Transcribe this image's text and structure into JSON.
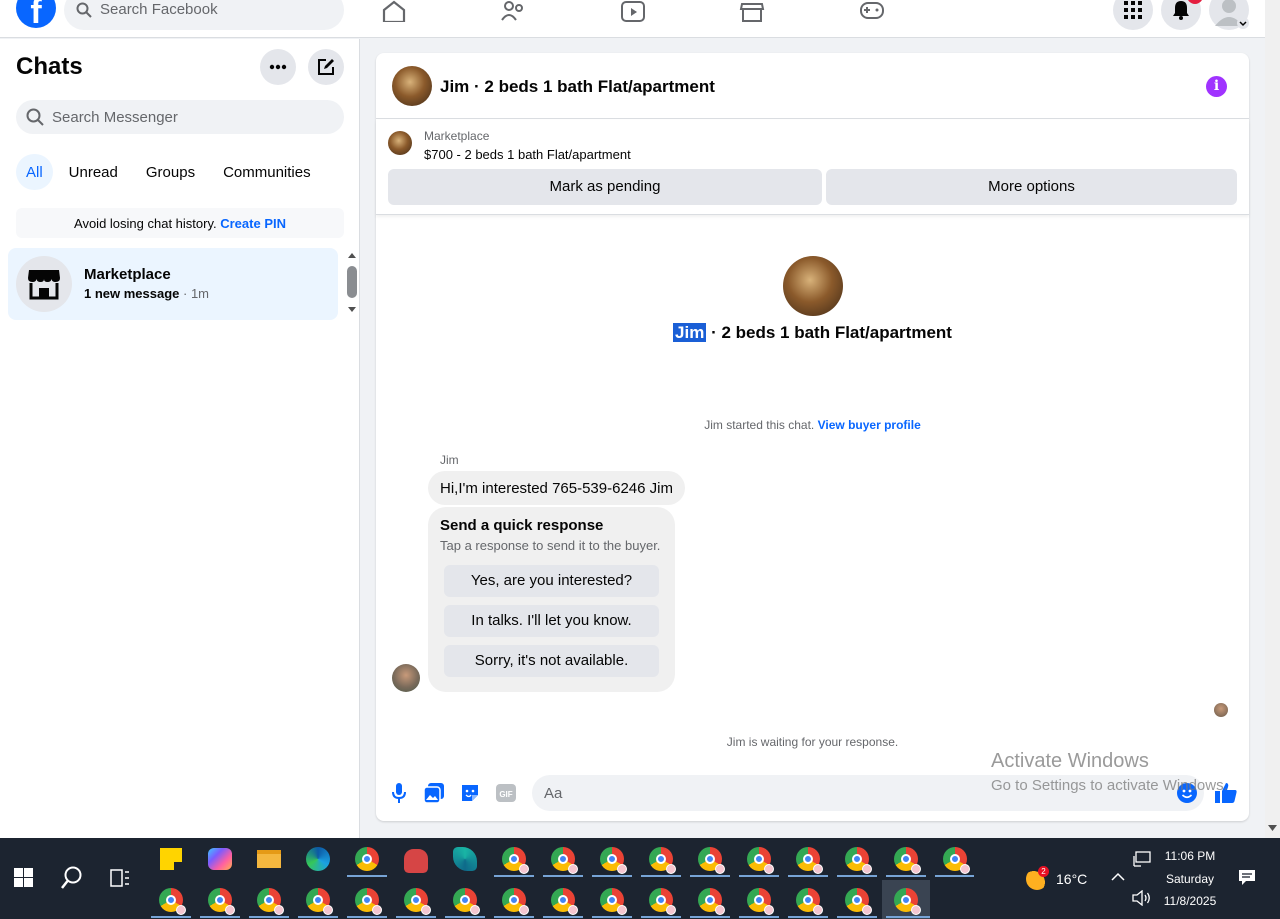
{
  "topnav": {
    "logo": "f",
    "search_placeholder": "Search Facebook",
    "icons": [
      "home-icon",
      "friends-icon",
      "video-icon",
      "marketplace-icon",
      "gaming-icon"
    ],
    "right_icons": [
      "menu-grid-icon",
      "bell-icon",
      "account-avatar"
    ]
  },
  "sidebar": {
    "title": "Chats",
    "search_placeholder": "Search Messenger",
    "filters": [
      {
        "label": "All",
        "active": true
      },
      {
        "label": "Unread"
      },
      {
        "label": "Groups"
      },
      {
        "label": "Communities"
      }
    ],
    "pin_banner": {
      "text": "Avoid losing chat history.",
      "link": "Create PIN"
    },
    "chats": [
      {
        "name": "Marketplace",
        "preview": "1 new message",
        "time": "· 1m"
      }
    ]
  },
  "conversation": {
    "title": "Jim · 2 beds 1 bath Flat/apartment",
    "marketplace": {
      "label": "Marketplace",
      "item": "$700 - 2 beds 1 bath Flat/apartment"
    },
    "buttons": {
      "pending": "Mark as pending",
      "more": "More options"
    },
    "center": {
      "name": "Jim",
      "rest": " · 2 beds 1 bath Flat/apartment"
    },
    "started": {
      "text": "Jim started this chat.",
      "link": "View buyer profile"
    },
    "sender": "Jim",
    "message": "Hi,I'm interested 765-539-6246 Jim",
    "quick_response": {
      "title": "Send a quick response",
      "subtitle": "Tap a response to send it to the buyer.",
      "options": [
        "Yes, are you interested?",
        "In talks. I'll let you know.",
        "Sorry, it's not available."
      ]
    },
    "waiting": "Jim is waiting for your response.",
    "composer_placeholder": "Aa"
  },
  "watermark": {
    "line1": "Activate Windows",
    "line2": "Go to Settings to activate Windows."
  },
  "taskbar": {
    "weather_temp": "16°C",
    "weather_badge": "2",
    "time": "11:06 PM",
    "day": "Saturday",
    "date": "11/8/2025"
  },
  "colors": {
    "accent": "#0866ff",
    "info": "#a033ff",
    "taskbar": "#1c2430"
  }
}
